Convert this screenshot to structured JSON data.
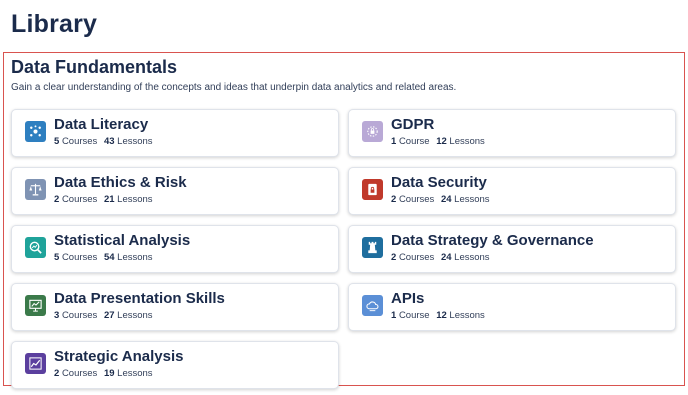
{
  "page": {
    "title": "Library"
  },
  "section": {
    "title": "Data Fundamentals",
    "description": "Gain a clear understanding of the concepts and ideas that underpin data analytics and related areas."
  },
  "labels": {
    "courses": "Courses",
    "course": "Course",
    "lessons": "Lessons"
  },
  "colors": {
    "section_border": "#d9534f",
    "title_text": "#1b2b4b"
  },
  "cards": [
    {
      "title": "Data Literacy",
      "courses": "5",
      "courses_label": "Courses",
      "lessons": "43",
      "lessons_label": "Lessons",
      "icon": "data-literacy-icon",
      "icon_color": "#2e7fc0"
    },
    {
      "title": "GDPR",
      "courses": "1",
      "courses_label": "Course",
      "lessons": "12",
      "lessons_label": "Lessons",
      "icon": "gdpr-icon",
      "icon_color": "#b9a9d6"
    },
    {
      "title": "Data Ethics & Risk",
      "courses": "2",
      "courses_label": "Courses",
      "lessons": "21",
      "lessons_label": "Lessons",
      "icon": "scales-icon",
      "icon_color": "#7f93b3"
    },
    {
      "title": "Data Security",
      "courses": "2",
      "courses_label": "Courses",
      "lessons": "24",
      "lessons_label": "Lessons",
      "icon": "lock-document-icon",
      "icon_color": "#c0392b"
    },
    {
      "title": "Statistical Analysis",
      "courses": "5",
      "courses_label": "Courses",
      "lessons": "54",
      "lessons_label": "Lessons",
      "icon": "magnifier-chart-icon",
      "icon_color": "#1fa39a"
    },
    {
      "title": "Data Strategy & Governance",
      "courses": "2",
      "courses_label": "Courses",
      "lessons": "24",
      "lessons_label": "Lessons",
      "icon": "chess-rook-icon",
      "icon_color": "#1f6e9e"
    },
    {
      "title": "Data Presentation Skills",
      "courses": "3",
      "courses_label": "Courses",
      "lessons": "27",
      "lessons_label": "Lessons",
      "icon": "presentation-board-icon",
      "icon_color": "#3b7a4a"
    },
    {
      "title": "APIs",
      "courses": "1",
      "courses_label": "Course",
      "lessons": "12",
      "lessons_label": "Lessons",
      "icon": "api-cloud-icon",
      "icon_color": "#5b8fd6"
    },
    {
      "title": "Strategic Analysis",
      "courses": "2",
      "courses_label": "Courses",
      "lessons": "19",
      "lessons_label": "Lessons",
      "icon": "line-chart-icon",
      "icon_color": "#5b3f9e"
    }
  ]
}
